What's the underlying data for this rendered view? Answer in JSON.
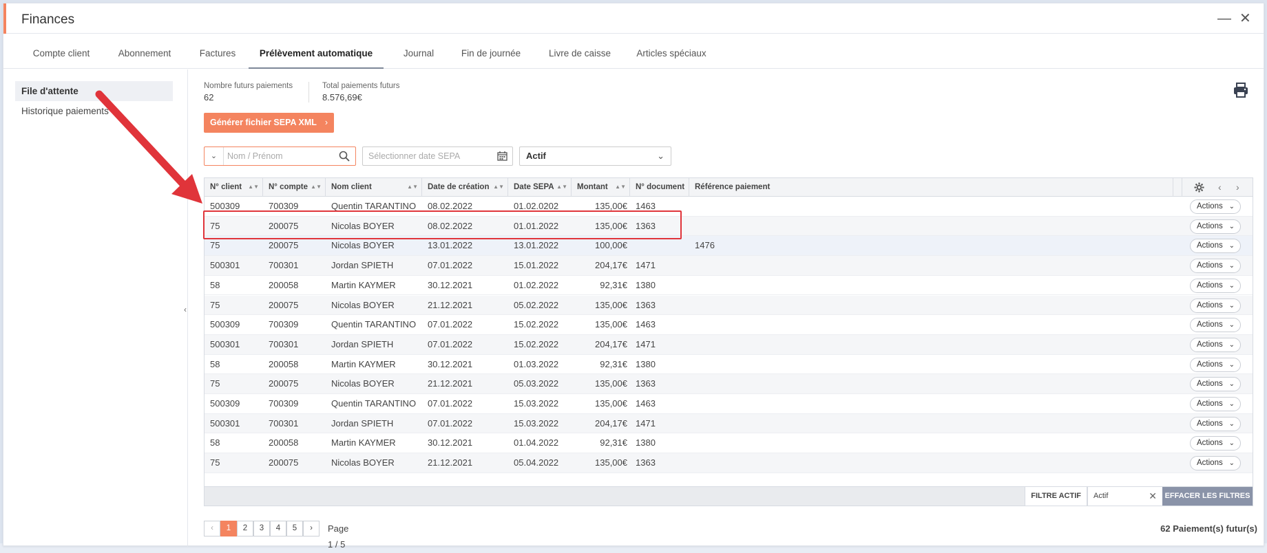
{
  "window": {
    "title": "Finances"
  },
  "tabs": [
    {
      "label": "Compte client"
    },
    {
      "label": "Abonnement"
    },
    {
      "label": "Factures"
    },
    {
      "label": "Prélèvement automatique"
    },
    {
      "label": "Journal"
    },
    {
      "label": "Fin de journée"
    },
    {
      "label": "Livre de caisse"
    },
    {
      "label": "Articles spéciaux"
    }
  ],
  "sidebar": {
    "items": [
      {
        "label": "File d'attente"
      },
      {
        "label": "Historique paiements"
      }
    ]
  },
  "stats": {
    "future_count_label": "Nombre futurs paiements",
    "future_count_value": "62",
    "future_total_label": "Total paiements futurs",
    "future_total_value": "8.576,69€"
  },
  "sepa_button": {
    "label": "Générer fichier SEPA XML"
  },
  "filters": {
    "name_placeholder": "Nom / Prénom",
    "date_placeholder": "Sélectionner date SEPA",
    "status_value": "Actif"
  },
  "table": {
    "columns": [
      "N° client",
      "N° compte",
      "Nom client",
      "Date de création",
      "Date SEPA",
      "Montant",
      "N° document",
      "Référence paiement"
    ],
    "action_label": "Actions",
    "rows": [
      [
        "500309",
        "700309",
        "Quentin TARANTINO",
        "08.02.2022",
        "01.02.0202",
        "135,00€",
        "1463",
        ""
      ],
      [
        "75",
        "200075",
        "Nicolas BOYER",
        "08.02.2022",
        "01.01.2022",
        "135,00€",
        "1363",
        ""
      ],
      [
        "75",
        "200075",
        "Nicolas BOYER",
        "13.01.2022",
        "13.01.2022",
        "100,00€",
        "",
        "1476"
      ],
      [
        "500301",
        "700301",
        "Jordan SPIETH",
        "07.01.2022",
        "15.01.2022",
        "204,17€",
        "1471",
        ""
      ],
      [
        "58",
        "200058",
        "Martin KAYMER",
        "30.12.2021",
        "01.02.2022",
        "92,31€",
        "1380",
        ""
      ],
      [
        "75",
        "200075",
        "Nicolas BOYER",
        "21.12.2021",
        "05.02.2022",
        "135,00€",
        "1363",
        ""
      ],
      [
        "500309",
        "700309",
        "Quentin TARANTINO",
        "07.01.2022",
        "15.02.2022",
        "135,00€",
        "1463",
        ""
      ],
      [
        "500301",
        "700301",
        "Jordan SPIETH",
        "07.01.2022",
        "15.02.2022",
        "204,17€",
        "1471",
        ""
      ],
      [
        "58",
        "200058",
        "Martin KAYMER",
        "30.12.2021",
        "01.03.2022",
        "92,31€",
        "1380",
        ""
      ],
      [
        "75",
        "200075",
        "Nicolas BOYER",
        "21.12.2021",
        "05.03.2022",
        "135,00€",
        "1363",
        ""
      ],
      [
        "500309",
        "700309",
        "Quentin TARANTINO",
        "07.01.2022",
        "15.03.2022",
        "135,00€",
        "1463",
        ""
      ],
      [
        "500301",
        "700301",
        "Jordan SPIETH",
        "07.01.2022",
        "15.03.2022",
        "204,17€",
        "1471",
        ""
      ],
      [
        "58",
        "200058",
        "Martin KAYMER",
        "30.12.2021",
        "01.04.2022",
        "92,31€",
        "1380",
        ""
      ],
      [
        "75",
        "200075",
        "Nicolas BOYER",
        "21.12.2021",
        "05.04.2022",
        "135,00€",
        "1363",
        ""
      ]
    ]
  },
  "footer": {
    "filter_active_label": "FILTRE ACTIF",
    "filter_value": "Actif",
    "clear_label": "EFFACER LES FILTRES"
  },
  "pagination": {
    "pages": [
      "1",
      "2",
      "3",
      "4",
      "5"
    ],
    "current": "1",
    "info": "Page 1 / 5",
    "total": "62 Paiement(s) futur(s)"
  },
  "colors": {
    "accent": "#f4845f",
    "highlight_box": "#e0343a",
    "clear_button": "#8a93a8"
  }
}
